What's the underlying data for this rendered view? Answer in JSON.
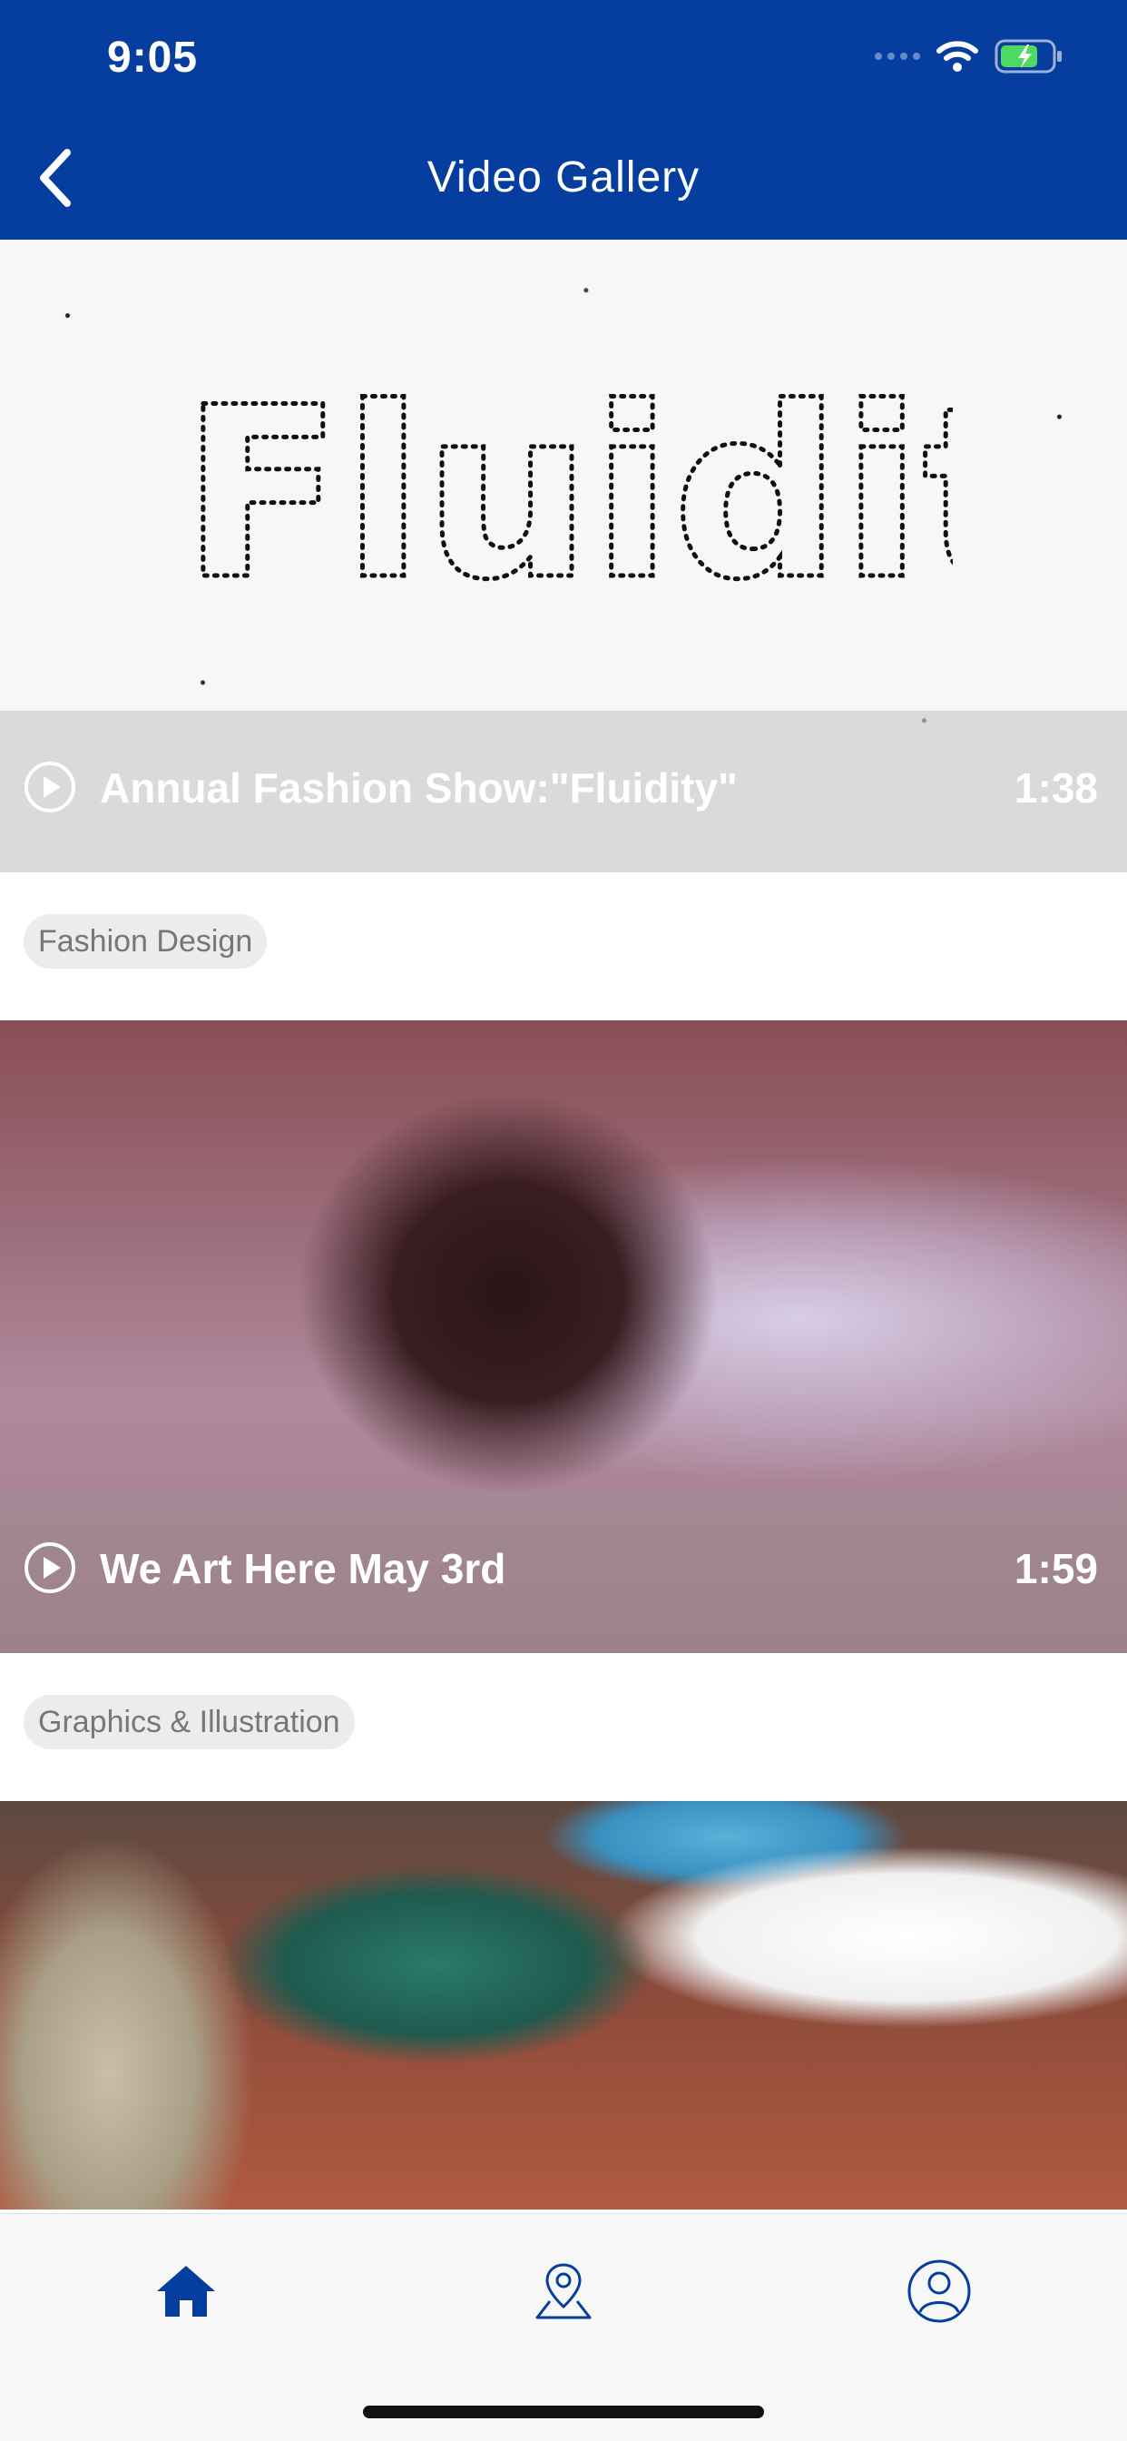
{
  "status_bar": {
    "time": "9:05"
  },
  "nav": {
    "title": "Video Gallery"
  },
  "videos": [
    {
      "title": "Annual Fashion Show:\"Fluidity\"",
      "duration": "1:38",
      "thumbnail_text": "Fluidity",
      "tag": "Fashion Design"
    },
    {
      "title": "We Art Here May 3rd",
      "duration": "1:59",
      "tag": "Graphics & Illustration"
    },
    {
      "title": "",
      "duration": ""
    }
  ],
  "tabbar": {
    "items": [
      "home-icon",
      "map-pin-icon",
      "profile-icon"
    ]
  },
  "colors": {
    "brand": "#053e9e",
    "tab_active": "#053e9e"
  }
}
